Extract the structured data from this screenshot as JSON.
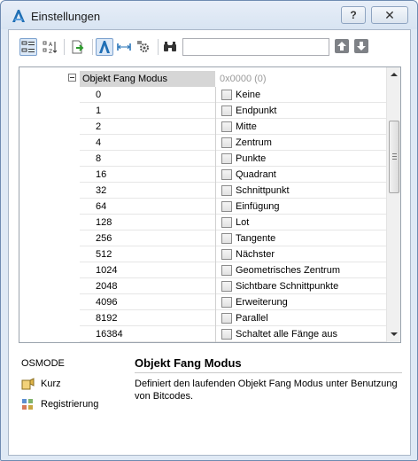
{
  "window": {
    "title": "Einstellungen",
    "help_glyph": "?",
    "close_glyph": "✕",
    "accent": "#1f6fb5"
  },
  "toolbar": {
    "buttons": [
      {
        "icon": "categorized-view-icon",
        "active": true
      },
      {
        "icon": "alphabetical-sort-icon",
        "active": false
      },
      {
        "icon": "export-icon",
        "active": false
      },
      {
        "icon": "autocad-variables-icon",
        "active": true
      },
      {
        "icon": "column-width-icon",
        "active": false
      },
      {
        "icon": "settings-gear-icon",
        "active": false
      },
      {
        "icon": "binoculars-icon",
        "active": false
      }
    ],
    "search_value": "",
    "search_placeholder": "",
    "prev_icon": "arrow-up-icon",
    "next_icon": "arrow-down-icon"
  },
  "grid": {
    "parameter_name": "Objekt Fang Modus",
    "parameter_value": "0x0000 (0)",
    "rows": [
      {
        "value": "0",
        "label": "Keine",
        "checked": false
      },
      {
        "value": "1",
        "label": "Endpunkt",
        "checked": false
      },
      {
        "value": "2",
        "label": "Mitte",
        "checked": false
      },
      {
        "value": "4",
        "label": "Zentrum",
        "checked": false
      },
      {
        "value": "8",
        "label": "Punkte",
        "checked": false
      },
      {
        "value": "16",
        "label": "Quadrant",
        "checked": false
      },
      {
        "value": "32",
        "label": "Schnittpunkt",
        "checked": false
      },
      {
        "value": "64",
        "label": "Einfügung",
        "checked": false
      },
      {
        "value": "128",
        "label": "Lot",
        "checked": false
      },
      {
        "value": "256",
        "label": "Tangente",
        "checked": false
      },
      {
        "value": "512",
        "label": "Nächster",
        "checked": false
      },
      {
        "value": "1024",
        "label": "Geometrisches Zentrum",
        "checked": false
      },
      {
        "value": "2048",
        "label": "Sichtbare Schnittpunkte",
        "checked": false
      },
      {
        "value": "4096",
        "label": "Erweiterung",
        "checked": false
      },
      {
        "value": "8192",
        "label": "Parallel",
        "checked": false
      },
      {
        "value": "16384",
        "label": "Schaltet alle Fänge aus",
        "checked": false
      }
    ]
  },
  "info": {
    "variable": "OSMODE",
    "link_short": "Kurz",
    "link_registry": "Registrierung",
    "title": "Objekt Fang Modus",
    "description": "Definiert den laufenden Objekt Fang Modus unter Benutzung von Bitcodes."
  }
}
